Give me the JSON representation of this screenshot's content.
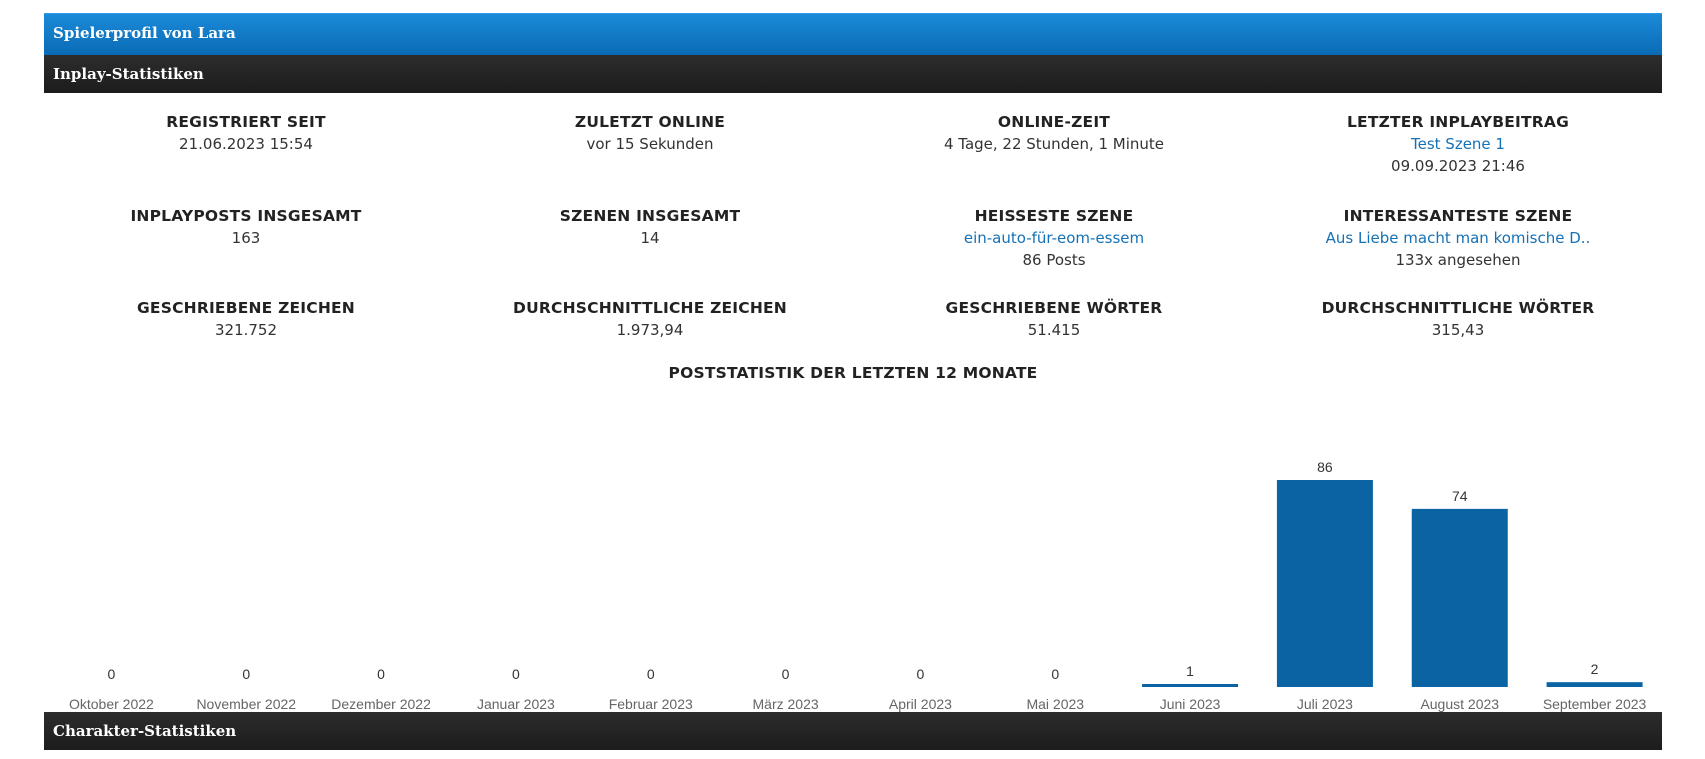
{
  "profile": {
    "title": "Spielerprofil von Lara"
  },
  "sections": {
    "inplay": "Inplay-Statistiken",
    "character": "Charakter-Statistiken"
  },
  "stats": {
    "registered": {
      "label": "REGISTRIERT SEIT",
      "value": "21.06.2023 15:54"
    },
    "last_online": {
      "label": "ZULETZT ONLINE",
      "value": "vor 15 Sekunden"
    },
    "online_time": {
      "label": "ONLINE-ZEIT",
      "value": "4 Tage, 22 Stunden, 1 Minute"
    },
    "last_post": {
      "label": "LETZTER INPLAYBEITRAG",
      "link": "Test Szene 1",
      "value": "09.09.2023 21:46"
    },
    "posts_total": {
      "label": "INPLAYPOSTS INSGESAMT",
      "value": "163"
    },
    "scenes_total": {
      "label": "SZENEN INSGESAMT",
      "value": "14"
    },
    "hottest_scene": {
      "label": "HEISSESTE SZENE",
      "link": "ein-auto-für-eom-essem",
      "value": "86 Posts"
    },
    "interesting_scene": {
      "label": "INTERESSANTESTE SZENE",
      "link": "Aus Liebe macht man komische D..",
      "value": "133x angesehen"
    },
    "chars_written": {
      "label": "GESCHRIEBENE ZEICHEN",
      "value": "321.752"
    },
    "chars_avg": {
      "label": "DURCHSCHNITTLICHE ZEICHEN",
      "value": "1.973,94"
    },
    "words_written": {
      "label": "GESCHRIEBENE WÖRTER",
      "value": "51.415"
    },
    "words_avg": {
      "label": "DURCHSCHNITTLICHE WÖRTER",
      "value": "315,43"
    }
  },
  "chart_data": {
    "type": "bar",
    "title": "POSTSTATISTIK DER LETZTEN 12 MONATE",
    "categories": [
      "Oktober 2022",
      "November 2022",
      "Dezember 2022",
      "Januar 2023",
      "Februar 2023",
      "März 2023",
      "April 2023",
      "Mai 2023",
      "Juni 2023",
      "Juli 2023",
      "August 2023",
      "September 2023"
    ],
    "values": [
      0,
      0,
      0,
      0,
      0,
      0,
      0,
      0,
      1,
      86,
      74,
      2
    ],
    "ylim": [
      0,
      86
    ],
    "bar_color": "#0a64a4",
    "grid": false,
    "legend": "none"
  }
}
